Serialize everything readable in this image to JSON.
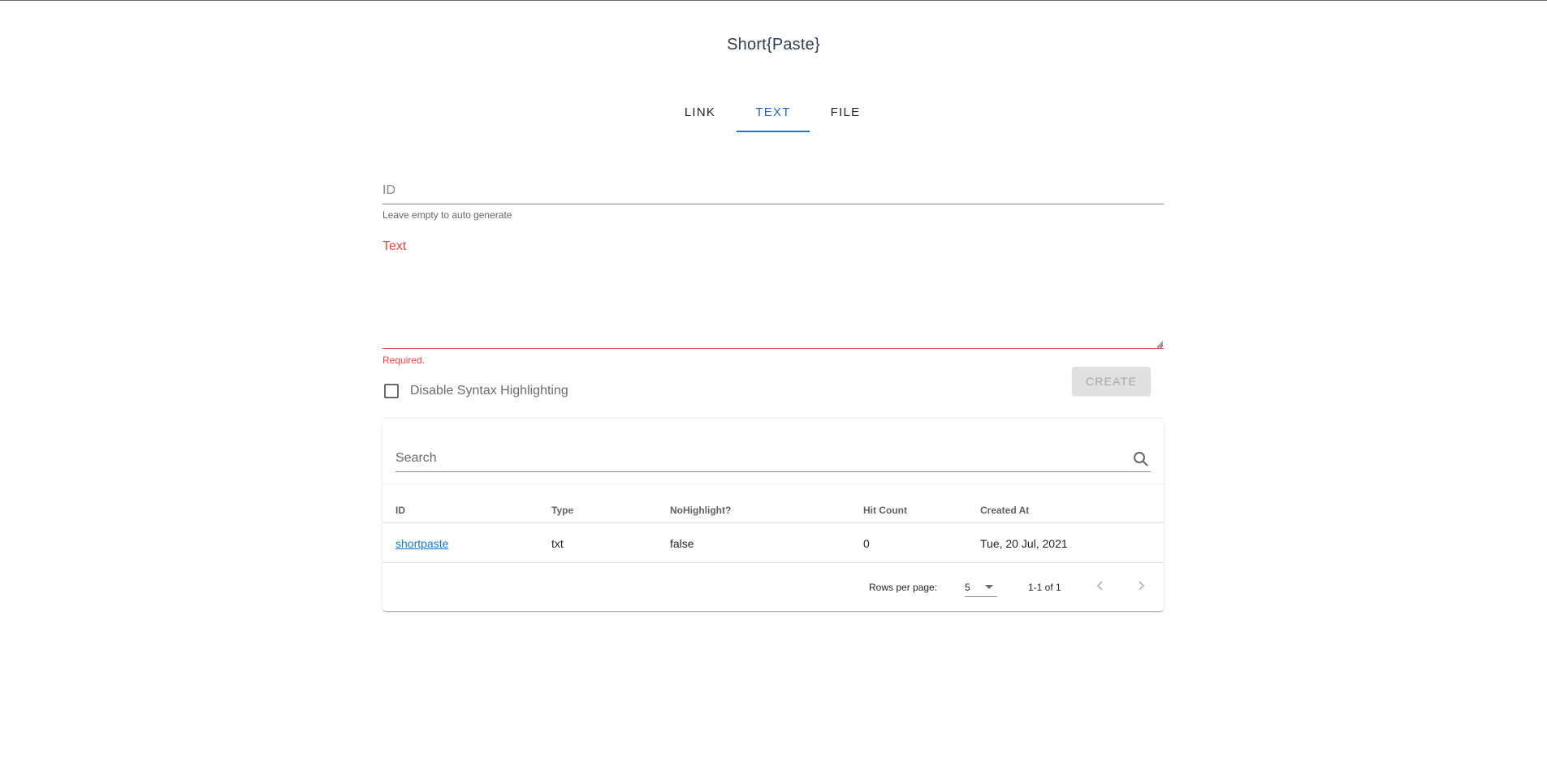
{
  "app": {
    "title": "Short{Paste}"
  },
  "tabs": [
    {
      "label": "LINK"
    },
    {
      "label": "TEXT"
    },
    {
      "label": "FILE"
    }
  ],
  "form": {
    "id_placeholder": "ID",
    "id_hint": "Leave empty to auto generate",
    "text_label": "Text",
    "text_error": "Required.",
    "checkbox_label": "Disable Syntax Highlighting",
    "create_label": "CREATE"
  },
  "table": {
    "search_placeholder": "Search",
    "headers": [
      "ID",
      "Type",
      "NoHighlight?",
      "Hit Count",
      "Created At"
    ],
    "rows": [
      {
        "id": "shortpaste",
        "type": "txt",
        "nohighlight": "false",
        "hit_count": "0",
        "created_at": "Tue, 20 Jul, 2021"
      }
    ],
    "rows_per_page_label": "Rows per page:",
    "rows_per_page_value": "5",
    "range": "1-1 of 1"
  },
  "colors": {
    "accent": "#1976d2",
    "error": "#ef4444"
  },
  "icons": [
    "search-icon",
    "chevron-down-icon",
    "chevron-left-icon",
    "chevron-right-icon"
  ]
}
